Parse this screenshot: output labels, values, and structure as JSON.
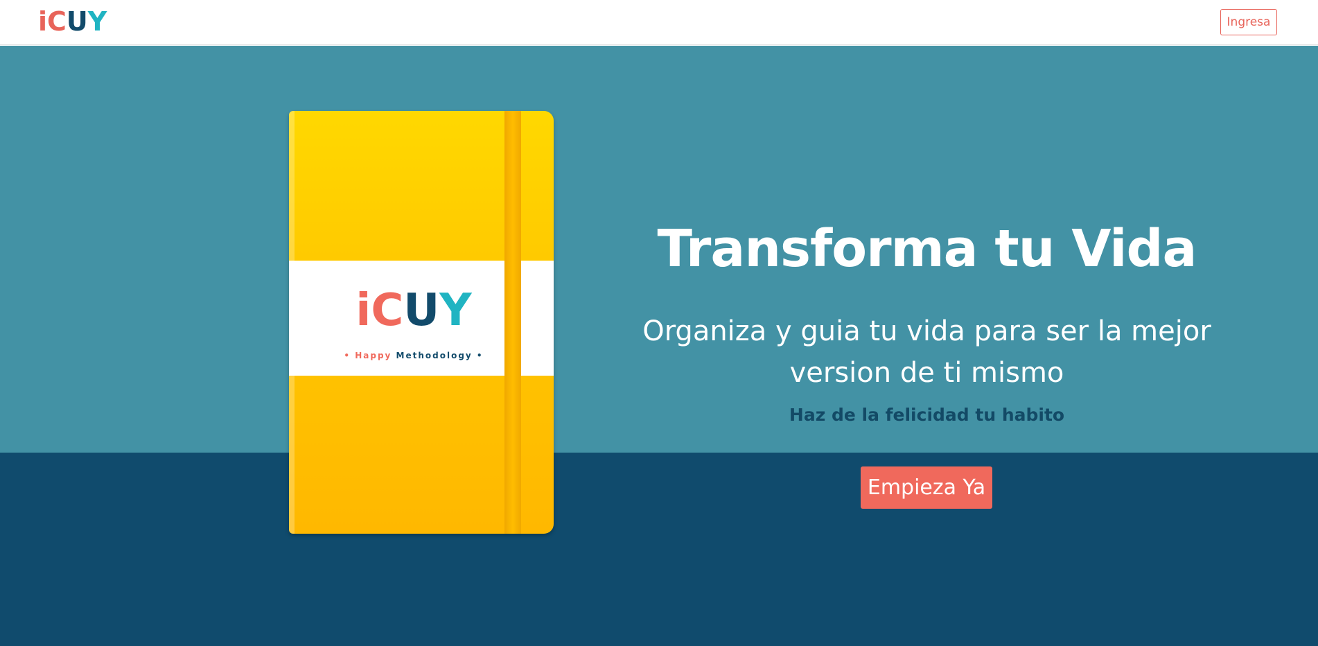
{
  "header": {
    "logo": {
      "letters": [
        "i",
        "C",
        "U",
        "Y"
      ],
      "colors": [
        "#e8645a",
        "#e8645a",
        "#124b6b",
        "#20b4c2"
      ]
    },
    "signin_label": "Ingresa"
  },
  "hero": {
    "title": "Transforma tu Vida",
    "subtitle": "Organiza y guia tu vida para ser la mejor version de ti mismo",
    "tagline": "Haz de la felicidad tu habito",
    "cta_label": "Empieza Ya"
  },
  "notebook": {
    "logo_letters": [
      "i",
      "C",
      "U",
      "Y"
    ],
    "tag_part1": "• Happy ",
    "tag_part2": "Methodology •"
  },
  "colors": {
    "hero_top": "#4392a5",
    "hero_bottom": "#104b6d",
    "accent": "#f0695c",
    "notebook": "#ffc600"
  }
}
